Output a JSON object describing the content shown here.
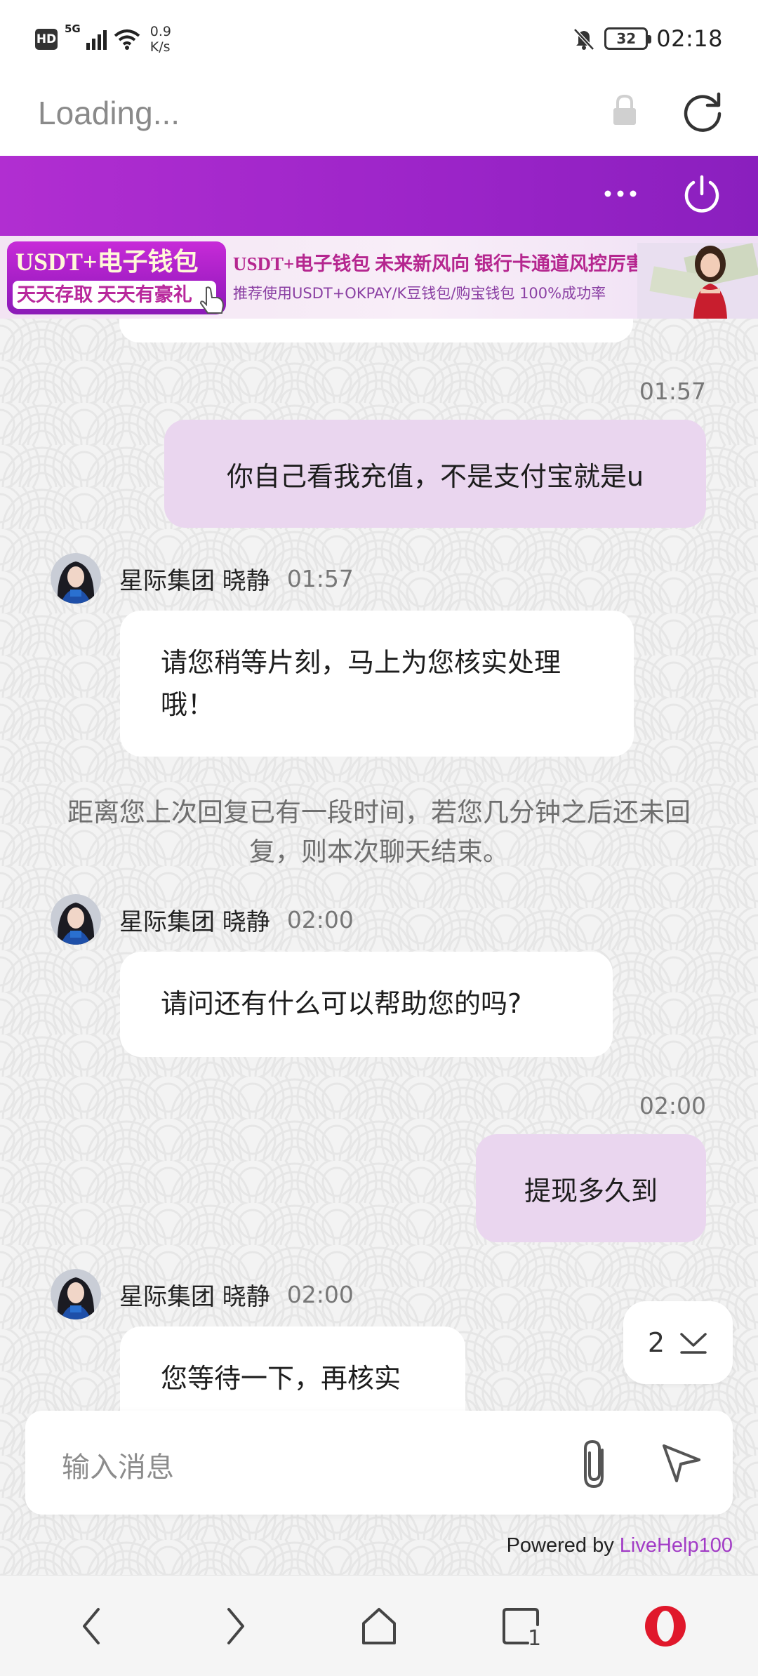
{
  "status_bar": {
    "hd": "HD",
    "network": "5G",
    "speed_value": "0.9",
    "speed_unit": "K/s",
    "battery": "32",
    "time": "02:18"
  },
  "browser": {
    "address_text": "Loading..."
  },
  "banner": {
    "left_top": "USDT+电子钱包",
    "left_bottom": "天天存取 天天有豪礼",
    "mid_top": "USDT+电子钱包   未来新风向   银行卡通道风控厉害",
    "mid_bottom": "推荐使用USDT+OKPAY/K豆钱包/购宝钱包   100%成功率"
  },
  "messages": {
    "m1_time": "01:57",
    "m1_text": "你自己看我充值，不是支付宝就是u",
    "m2_agent": "星际集团 晓静",
    "m2_time": "01:57",
    "m2_text": "请您稍等片刻，马上为您核实处理哦！",
    "system_note": "距离您上次回复已有一段时间，若您几分钟之后还未回复，则本次聊天结束。",
    "m3_agent": "星际集团 晓静",
    "m3_time": "02:00",
    "m3_text": "请问还有什么可以帮助您的吗?",
    "m4_time": "02:00",
    "m4_text": "提现多久到",
    "m5_agent": "星际集团 晓静",
    "m5_time": "02:00",
    "m5_text": "您等待一下，再核实"
  },
  "scroll_badge": {
    "count": "2"
  },
  "input": {
    "placeholder": "输入消息"
  },
  "footer": {
    "powered_prefix": "Powered by ",
    "powered_brand": "LiveHelp100"
  },
  "bottom_nav": {
    "tabs_count": "1"
  },
  "colors": {
    "header_purple": "#a424cb",
    "outgoing_bubble": "#ead6ef",
    "brand_link": "#a23cc6",
    "opera_red": "#e0182b"
  },
  "icons": [
    "wifi-icon",
    "mute-icon",
    "lock-icon",
    "reload-icon",
    "more-icon",
    "power-icon",
    "attach-icon",
    "send-icon",
    "chevron-down-icon",
    "back-icon",
    "forward-icon",
    "home-icon",
    "tabs-icon",
    "opera-icon"
  ]
}
